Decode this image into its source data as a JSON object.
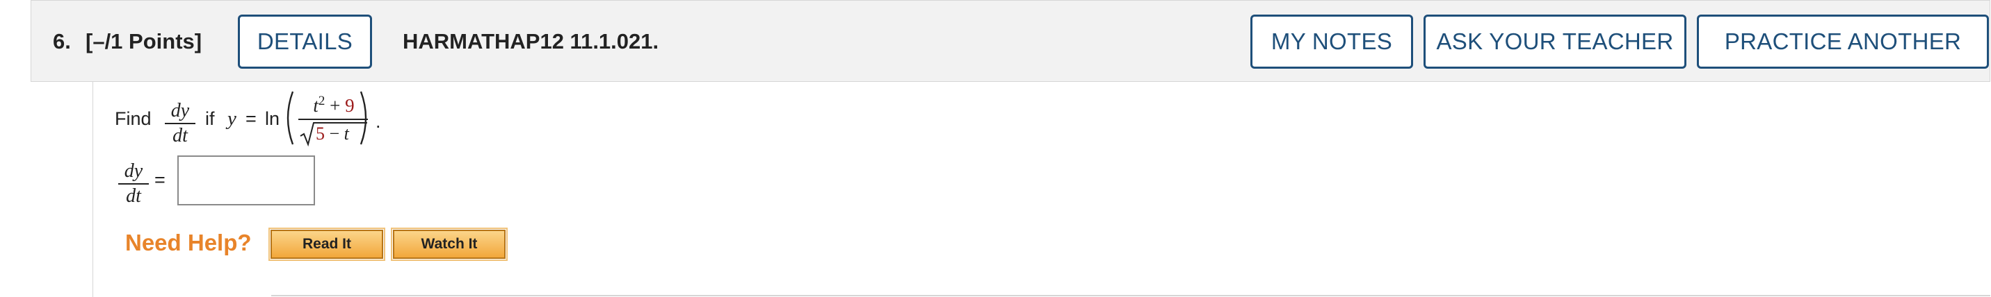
{
  "question": {
    "number": "6.",
    "points": "[–/1 Points]",
    "details_label": "DETAILS",
    "code": "HARMATHAP12 11.1.021.",
    "my_notes_label": "MY NOTES",
    "ask_teacher_label": "ASK YOUR TEACHER",
    "practice_another_label": "PRACTICE ANOTHER"
  },
  "problem": {
    "find_label": "Find",
    "deriv_num": "dy",
    "deriv_den": "dt",
    "if_label": "if",
    "y_var": "y",
    "equals": "=",
    "ln": "ln",
    "numerator_var": "t",
    "numerator_exp": "2",
    "plus": "+",
    "numerator_const": "9",
    "sqrt_const": "5",
    "minus": "−",
    "sqrt_var": "t",
    "period": "."
  },
  "answer": {
    "lhs_num": "dy",
    "lhs_den": "dt",
    "equals": "=",
    "value": ""
  },
  "help": {
    "need_help_label": "Need Help?",
    "read_it_label": "Read It",
    "watch_it_label": "Watch It"
  },
  "colors": {
    "button_border": "#1e4f7a",
    "need_help": "#e8842a",
    "highlight_value": "#9c1c1c",
    "help_button_fill": "#f2a73b"
  }
}
